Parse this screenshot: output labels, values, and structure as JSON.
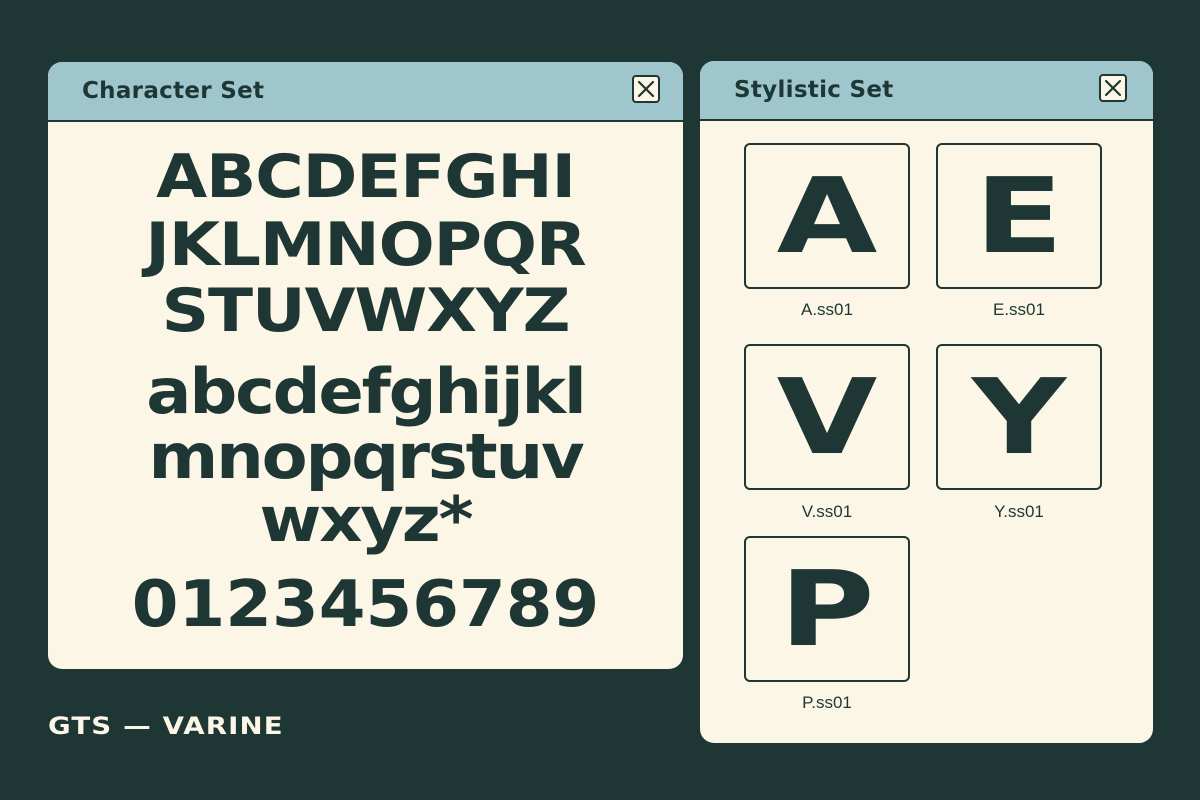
{
  "character_set_window": {
    "title": "Character Set",
    "close_icon": "close-icon",
    "uppercase_lines": [
      "ABCDEFGHI",
      "JKLMNOPQR",
      "STUVWXYZ"
    ],
    "lowercase_lines": [
      "abcdefghijkl",
      "mnopqrstuv",
      "wxyz*"
    ],
    "digits_line": "0123456789"
  },
  "stylistic_set_window": {
    "title": "Stylistic Set",
    "close_icon": "close-icon",
    "alternates": [
      {
        "glyph": "A",
        "label": "A.ss01"
      },
      {
        "glyph": "E",
        "label": "E.ss01"
      },
      {
        "glyph": "V",
        "label": "V.ss01"
      },
      {
        "glyph": "Y",
        "label": "Y.ss01"
      },
      {
        "glyph": "P",
        "label": "P.ss01"
      }
    ]
  },
  "brand": "GTS — VARINE",
  "colors": {
    "background": "#1e3634",
    "window_body": "#fcf6e6",
    "title_bar": "#9fc5cd",
    "ink": "#1e3634"
  }
}
